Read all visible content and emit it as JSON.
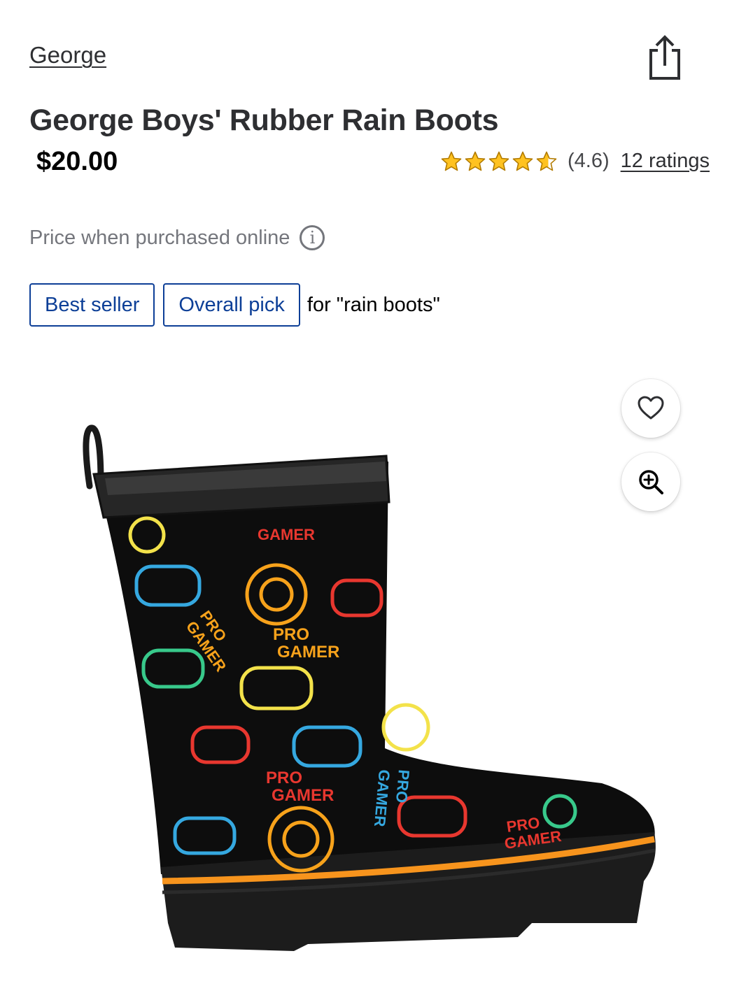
{
  "brand": "George",
  "product": {
    "title": "George Boys' Rubber Rain Boots",
    "price": "$20.00",
    "price_note": "Price when purchased online"
  },
  "rating": {
    "value": 4.6,
    "text": "(4.6)",
    "count_label": "12 ratings",
    "star_color": "#ffc220"
  },
  "badges": {
    "items": [
      "Best seller",
      "Overall pick"
    ],
    "suffix": "for \"rain boots\"",
    "color": "#0d3f97"
  },
  "image": {
    "print_text": [
      "PRO",
      "GAMER"
    ]
  },
  "icons": {
    "share": "share-icon",
    "info": "info-icon",
    "favorite": "heart-icon",
    "zoom": "zoom-in-icon"
  }
}
